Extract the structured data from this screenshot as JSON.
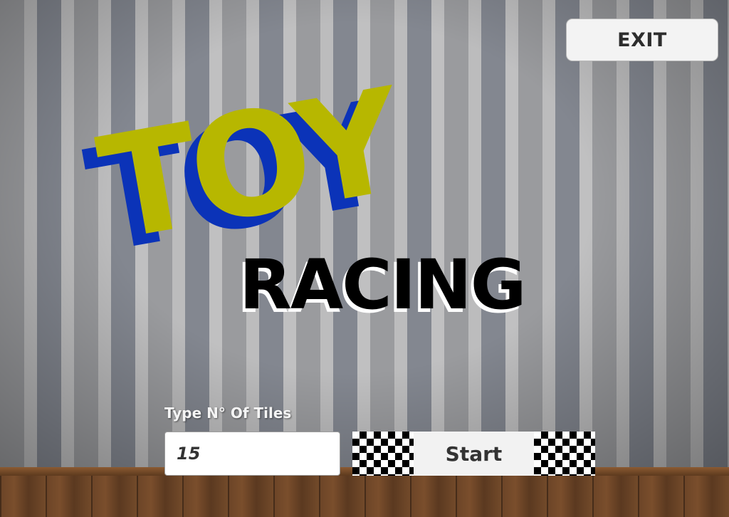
{
  "header": {
    "exit_label": "EXIT"
  },
  "logo": {
    "line1": "TOY",
    "line2": "RACING"
  },
  "tiles": {
    "label": "Type N° Of Tiles",
    "value": "15"
  },
  "start": {
    "label": "Start"
  },
  "colors": {
    "logo_yellow": "#b7b700",
    "logo_blue": "#0b33b8",
    "logo_black": "#000000"
  }
}
